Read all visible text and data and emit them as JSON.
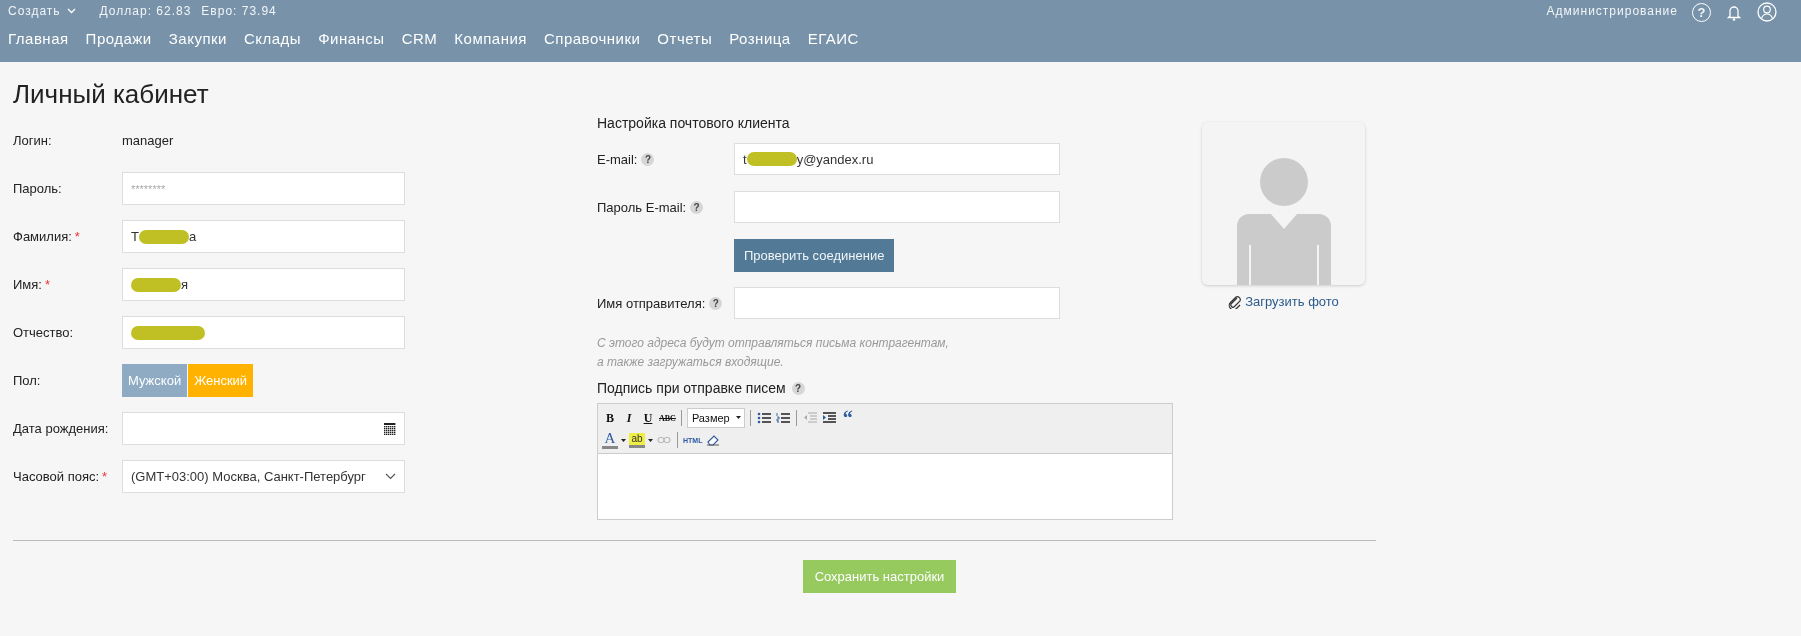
{
  "top_bar": {
    "create_menu": "Создать",
    "rates": [
      "Доллар: 62.83",
      "Евро: 73.94"
    ],
    "admin_link": "Администрирование",
    "help_icon": "?"
  },
  "nav": [
    "Главная",
    "Продажи",
    "Закупки",
    "Склады",
    "Финансы",
    "CRM",
    "Компания",
    "Справочники",
    "Отчеты",
    "Розница",
    "ЕГАИС"
  ],
  "page_title": "Личный кабинет",
  "profile_fields": [
    {
      "kind": "static",
      "label": "Логин:",
      "value": "manager"
    },
    {
      "kind": "input",
      "label": "Пароль:",
      "placeholder": "********"
    },
    {
      "kind": "input",
      "label": "Фамилия:",
      "required_mark": "*",
      "value_start": "Т",
      "value_end": "а",
      "redacted": true
    },
    {
      "kind": "input",
      "label": "Имя:",
      "required_mark": "*",
      "value_end": "я",
      "redacted": true
    },
    {
      "kind": "input",
      "label": "Отчество:",
      "redacted": true
    },
    {
      "kind": "toggle",
      "label": "Пол:",
      "options": [
        {
          "label": "Мужской",
          "selected": false
        },
        {
          "label": "Женский",
          "selected": true
        }
      ]
    },
    {
      "kind": "date",
      "label": "Дата рождения:"
    },
    {
      "kind": "select",
      "label": "Часовой пояс:",
      "required_mark": "*",
      "value": "(GMT+03:00) Москва, Санкт-Петербург"
    }
  ],
  "mail_settings": {
    "title": "Настройка почтового клиента",
    "fields": [
      {
        "kind": "input",
        "label": "E-mail:",
        "help": "?",
        "value_start": "t",
        "value_end": "y@yandex.ru",
        "redacted": true
      },
      {
        "kind": "input",
        "label": "Пароль E-mail:",
        "help": "?"
      },
      {
        "kind": "button",
        "label": "Проверить соединение"
      },
      {
        "kind": "input",
        "label": "Имя отправителя:",
        "help": "?"
      }
    ],
    "hint": "С этого адреса будут отправляться письма контрагентам,\nа также загружаться входящие.",
    "signature": {
      "label": "Подпись при отправке писем",
      "help": "?",
      "toolbar": [
        [
          {
            "kind": "bold",
            "label": "B"
          },
          {
            "kind": "italic",
            "label": "I"
          },
          {
            "kind": "underline",
            "label": "U"
          },
          {
            "kind": "strike",
            "label": "ABC"
          },
          {
            "kind": "separator"
          },
          {
            "kind": "size",
            "label": "Размер"
          },
          {
            "kind": "separator"
          },
          {
            "kind": "bullets"
          },
          {
            "kind": "numbers"
          },
          {
            "kind": "separator"
          },
          {
            "kind": "outdent"
          },
          {
            "kind": "indent"
          },
          {
            "kind": "quote",
            "label": "“"
          }
        ],
        [
          {
            "kind": "font_color",
            "label": "A"
          },
          {
            "kind": "highlight",
            "label": "ab"
          },
          {
            "kind": "link"
          },
          {
            "kind": "separator"
          },
          {
            "kind": "html",
            "label": "HTML"
          },
          {
            "kind": "eraser"
          }
        ]
      ]
    }
  },
  "photo": {
    "upload_link": "Загрузить фото"
  },
  "save_button": "Сохранить настройки"
}
